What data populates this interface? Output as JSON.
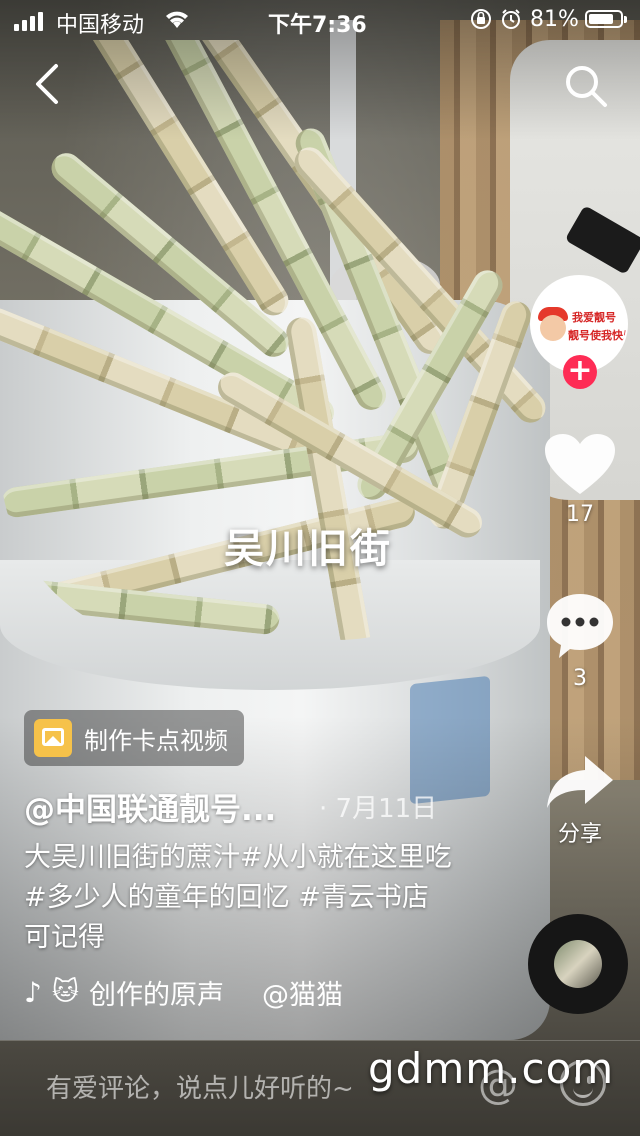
{
  "status_bar": {
    "carrier": "中国移动",
    "time": "下午7:36",
    "battery_percent_text": "81%",
    "battery_level": 0.81
  },
  "overlay": {
    "center_text": "吴川旧街"
  },
  "right_rail": {
    "avatar_text_1": "我爱靓号",
    "avatar_text_2": "靓号使我快乐",
    "follow_symbol": "+",
    "like_count": "17",
    "comment_count": "3",
    "share_label": "分享"
  },
  "post": {
    "template_pill": "制作卡点视频",
    "author": "@中国联通靓号...",
    "date": "· 7月11日",
    "caption": "大吴川旧街的蔗汁#从小就在这里吃#多少人的童年的回忆 #青云书店可记得",
    "music_emoji": "🐱",
    "music_title": "创作的原声",
    "music_author": "@猫猫"
  },
  "bottom_bar": {
    "comment_placeholder": "有爱评论，说点儿好听的~",
    "at_symbol": "@",
    "watermark": "gdmm.com"
  },
  "icons": {
    "back": "chevron-left-icon",
    "search": "search-icon",
    "like": "heart-icon",
    "comment": "comment-bubble-icon",
    "share": "share-arrow-icon",
    "music": "tiktok-note-icon",
    "emoji": "smiley-icon"
  },
  "colors": {
    "follow_red": "#fe2c55",
    "pill_icon_yellow": "#f6c24a"
  }
}
